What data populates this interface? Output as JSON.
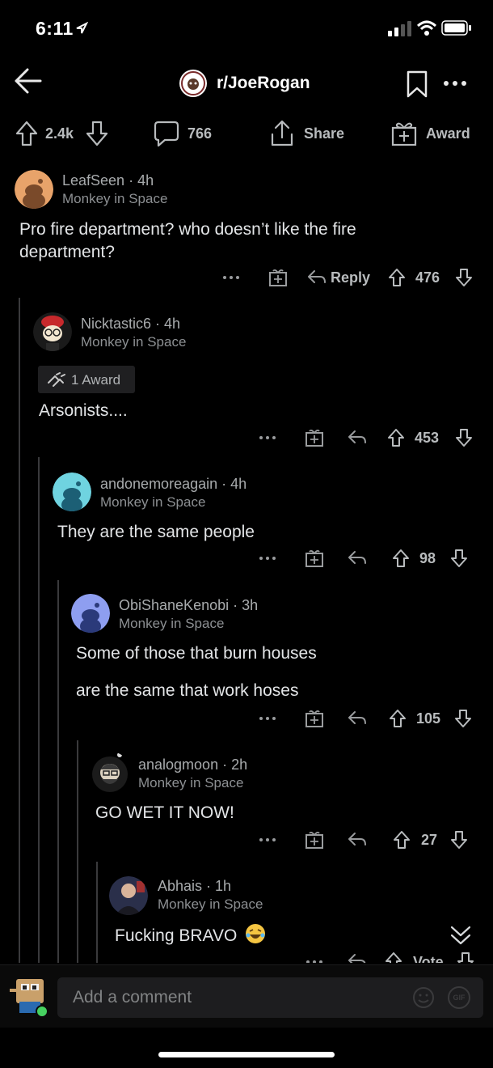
{
  "status": {
    "time": "6:11"
  },
  "nav": {
    "subreddit": "r/JoeRogan"
  },
  "post_actions": {
    "votes": "2.4k",
    "comments": "766",
    "share": "Share",
    "award": "Award"
  },
  "comments": [
    {
      "user": "LeafSeen",
      "age": "4h",
      "flair": "Monkey in Space",
      "text": "Pro fire department? who doesn’t like the fire department?",
      "reply": "Reply",
      "score": "476"
    },
    {
      "user": "Nicktastic6",
      "age": "4h",
      "flair": "Monkey in Space",
      "award": "1 Award",
      "text": "Arsonists....",
      "score": "453"
    },
    {
      "user": "andonemoreagain",
      "age": "4h",
      "flair": "Monkey in Space",
      "text": "They are the same people",
      "score": "98"
    },
    {
      "user": "ObiShaneKenobi",
      "age": "3h",
      "flair": "Monkey in Space",
      "text1": "Some of those that burn houses",
      "text2": "are the same that work hoses",
      "score": "105"
    },
    {
      "user": "analogmoon",
      "age": "2h",
      "flair": "Monkey in Space",
      "text": "GO WET IT NOW!",
      "score": "27"
    },
    {
      "user": "Abhais",
      "age": "1h",
      "flair": "Monkey in Space",
      "text": "Fucking BRAVO",
      "vote": "Vote"
    }
  ],
  "composer": {
    "placeholder": "Add a comment",
    "gif": "GIF"
  },
  "icons": [
    "back-arrow-icon",
    "subreddit-icon",
    "bookmark-icon",
    "more-icon",
    "upvote-icon",
    "downvote-icon",
    "comment-icon",
    "share-icon",
    "award-icon",
    "reply-icon",
    "emoji-icon",
    "gif-icon"
  ]
}
